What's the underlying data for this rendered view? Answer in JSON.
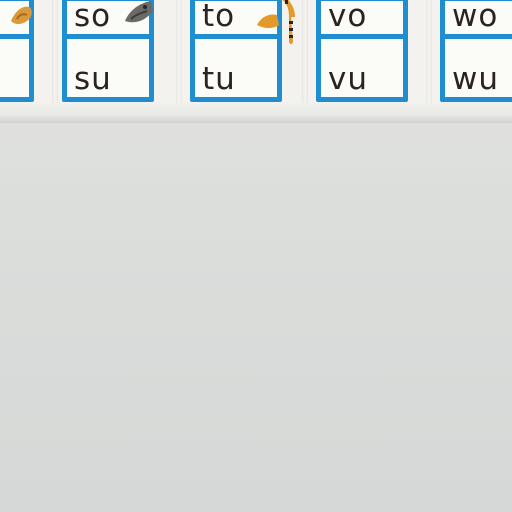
{
  "syllable_cards": [
    {
      "top": "so",
      "bottom": "su"
    },
    {
      "top": "to",
      "bottom": "tu"
    },
    {
      "top": "vo",
      "bottom": "vu"
    },
    {
      "top": "wo",
      "bottom": "wu"
    }
  ],
  "colors": {
    "card_border": "#1f8ed0",
    "wall": "#dadcdb",
    "text": "#2a2322"
  },
  "icons": [
    "dog-illustration",
    "fox-illustration",
    "gray-animal-illustration",
    "tiger-illustration"
  ]
}
